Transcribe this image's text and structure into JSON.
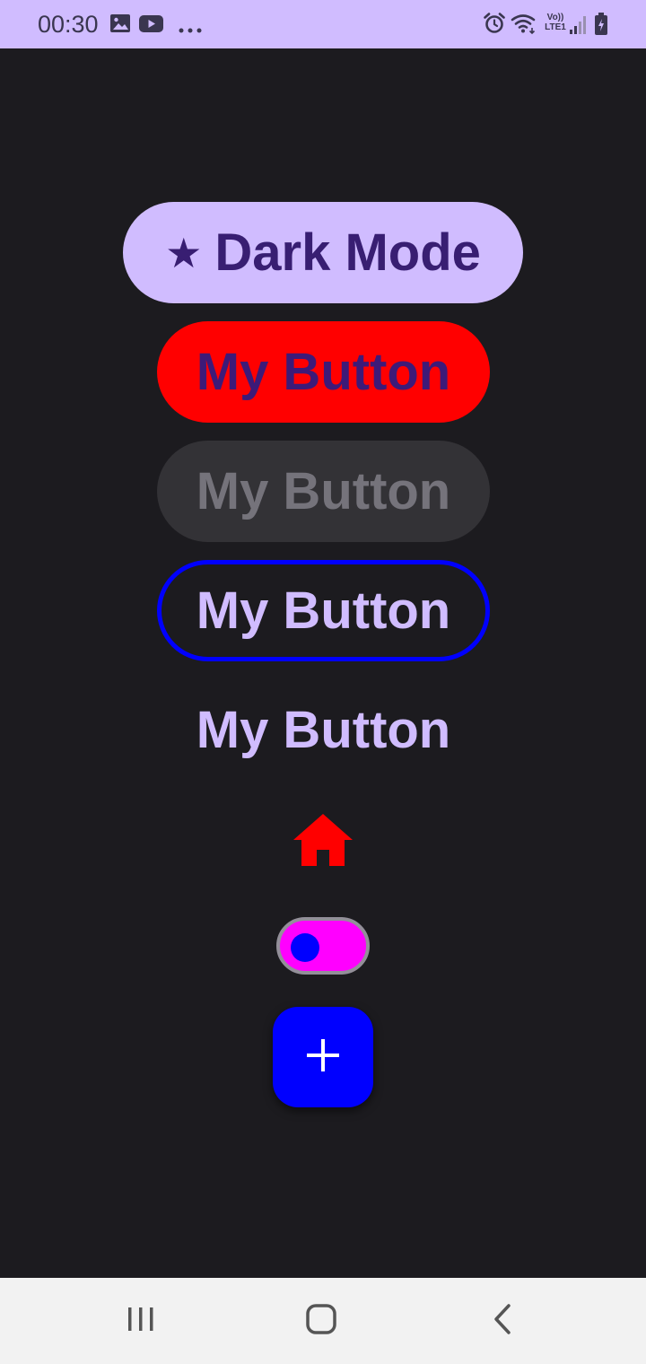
{
  "status_bar": {
    "time": "00:30",
    "left_icons": [
      "image-icon",
      "youtube-icon",
      "more-icon"
    ],
    "right_icons": [
      "alarm-icon",
      "wifi-icon",
      "volte-lte-icon",
      "signal-icon",
      "battery-charging-icon"
    ],
    "volte_text": "Vo))",
    "lte_text": "LTE1"
  },
  "buttons": {
    "dark_mode_icon": "★",
    "dark_mode_label": "Dark Mode",
    "red_label": "My Button",
    "disabled_label": "My Button",
    "outlined_label": "My Button",
    "text_label": "My Button"
  },
  "icon_button": {
    "icon": "home-icon",
    "color": "#ff0000"
  },
  "switch": {
    "checked": false,
    "track_color": "#ff00ff",
    "thumb_color": "#0000ff"
  },
  "fab": {
    "icon": "add-icon",
    "color": "#0000ff"
  },
  "nav_bar": {
    "items": [
      "recents-icon",
      "home-icon",
      "back-icon"
    ]
  },
  "colors": {
    "primary": "#d0bcff",
    "background": "#1c1b1f",
    "red": "#ff0000",
    "blue": "#0000ff",
    "magenta": "#ff00ff"
  }
}
